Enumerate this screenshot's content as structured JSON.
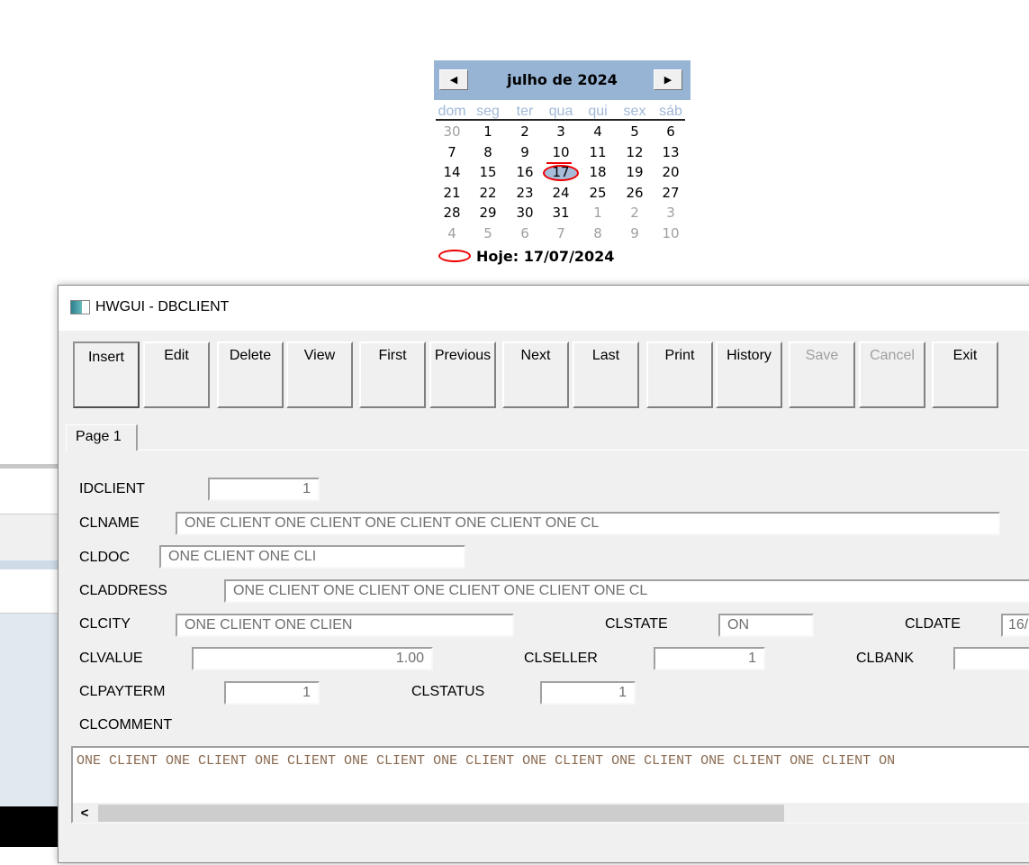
{
  "calendar": {
    "title": "julho de 2024",
    "prev_icon": "◀",
    "next_icon": "▶",
    "weekdays": [
      "dom",
      "seg",
      "ter",
      "qua",
      "qui",
      "sex",
      "sáb"
    ],
    "weeks": [
      [
        "30",
        "1",
        "2",
        "3",
        "4",
        "5",
        "6"
      ],
      [
        "7",
        "8",
        "9",
        "10",
        "11",
        "12",
        "13"
      ],
      [
        "14",
        "15",
        "16",
        "17",
        "18",
        "19",
        "20"
      ],
      [
        "21",
        "22",
        "23",
        "24",
        "25",
        "26",
        "27"
      ],
      [
        "28",
        "29",
        "30",
        "31",
        "1",
        "2",
        "3"
      ],
      [
        "4",
        "5",
        "6",
        "7",
        "8",
        "9",
        "10"
      ]
    ],
    "selected_day": "17",
    "today_label": "Hoje: 17/07/2024"
  },
  "window": {
    "title": "HWGUI - DBCLIENT",
    "toolbar": [
      {
        "label": "Insert",
        "enabled": true,
        "default": true
      },
      {
        "label": "Edit",
        "enabled": true
      },
      {
        "label": "Delete",
        "enabled": true
      },
      {
        "label": "View",
        "enabled": true
      },
      {
        "label": "First",
        "enabled": true
      },
      {
        "label": "Previous",
        "enabled": true
      },
      {
        "label": "Next",
        "enabled": true
      },
      {
        "label": "Last",
        "enabled": true
      },
      {
        "label": "Print",
        "enabled": true
      },
      {
        "label": "History",
        "enabled": true
      },
      {
        "label": "Save",
        "enabled": false
      },
      {
        "label": "Cancel",
        "enabled": false
      },
      {
        "label": "Exit",
        "enabled": true
      }
    ],
    "tab": "Page 1",
    "fields": {
      "idclient": {
        "label": "IDCLIENT",
        "value": "1"
      },
      "clname": {
        "label": "CLNAME",
        "value": "ONE CLIENT ONE CLIENT ONE CLIENT ONE CLIENT ONE CL"
      },
      "cldoc": {
        "label": "CLDOC",
        "value": "ONE CLIENT ONE CLI"
      },
      "claddress": {
        "label": "CLADDRESS",
        "value": "ONE CLIENT ONE CLIENT ONE CLIENT ONE CLIENT ONE CL"
      },
      "clcity": {
        "label": "CLCITY",
        "value": "ONE CLIENT ONE CLIEN"
      },
      "clstate": {
        "label": "CLSTATE",
        "value": "ON"
      },
      "cldate": {
        "label": "CLDATE",
        "value": "16/"
      },
      "clvalue": {
        "label": "CLVALUE",
        "value": "1.00"
      },
      "clseller": {
        "label": "CLSELLER",
        "value": "1"
      },
      "clbank": {
        "label": "CLBANK",
        "value": ""
      },
      "clpayterm": {
        "label": "CLPAYTERM",
        "value": "1"
      },
      "clstatus": {
        "label": "CLSTATUS",
        "value": "1"
      },
      "clcomment": {
        "label": "CLCOMMENT",
        "value": "ONE CLIENT ONE CLIENT ONE CLIENT ONE CLIENT ONE CLIENT ONE CLIENT ONE CLIENT ONE CLIENT ONE CLIENT ON"
      }
    },
    "scroll_left_icon": "<"
  }
}
